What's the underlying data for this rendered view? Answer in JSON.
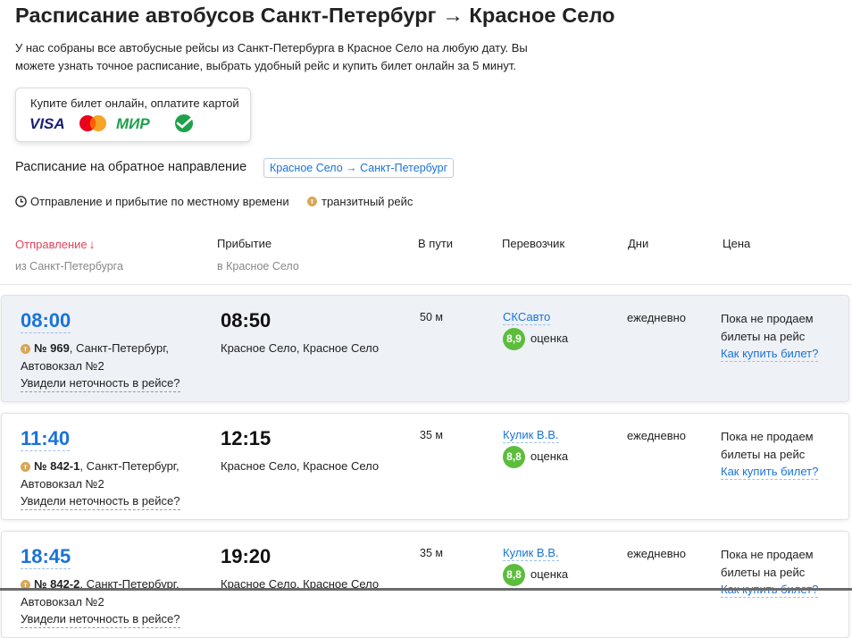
{
  "page": {
    "title": "Расписание автобусов Санкт-Петербург → Красное Село",
    "intro": "У нас собраны все автобусные рейсы из Санкт-Петербурга в Красное Село на любую дату. Вы можете узнать точное расписание, выбрать удобный рейс и купить билет онлайн за 5 минут."
  },
  "payment": {
    "label": "Купите билет онлайн, оплатите картой",
    "logos": [
      "visa",
      "mastercard",
      "mir",
      "sberbank"
    ]
  },
  "reverse": {
    "label": "Расписание на обратное направление",
    "link": "Красное Село → Санкт-Петербург"
  },
  "legend": {
    "local_time": "Отправление и прибытие по местному времени",
    "transit": "транзитный рейс",
    "transit_badge": "т"
  },
  "table": {
    "headers": {
      "departure": "Отправление",
      "departure_sort": "↓",
      "departure_sub": "из Санкт-Петербурга",
      "arrival": "Прибытие",
      "arrival_sub": "в Красное Село",
      "duration": "В пути",
      "carrier": "Перевозчик",
      "days": "Дни",
      "price": "Цена"
    },
    "rows": [
      {
        "departure": "08:00",
        "route_number": "№ 969",
        "route_from": ", Санкт-Петербург, Автовокзал №2",
        "report": "Увидели неточность в рейсе?",
        "arrival": "08:50",
        "arrival_place": "Красное Село, Красное Село",
        "duration": "50 м",
        "carrier": "СКСавто",
        "rating": "8,9",
        "rating_label": "оценка",
        "days": "ежедневно",
        "price_text": "Пока не продаем билеты на рейс",
        "how_to_buy": "Как купить билет?"
      },
      {
        "departure": "11:40",
        "route_number": "№ 842-1",
        "route_from": ", Санкт-Петербург, Автовокзал №2",
        "report": "Увидели неточность в рейсе?",
        "arrival": "12:15",
        "arrival_place": "Красное Село, Красное Село",
        "duration": "35 м",
        "carrier": "Кулик В.В.",
        "rating": "8,8",
        "rating_label": "оценка",
        "days": "ежедневно",
        "price_text": "Пока не продаем билеты на рейс",
        "how_to_buy": "Как купить билет?"
      },
      {
        "departure": "18:45",
        "route_number": "№ 842-2",
        "route_from": ", Санкт-Петербург, Автовокзал №2",
        "report": "Увидели неточность в рейсе?",
        "arrival": "19:20",
        "arrival_place": "Красное Село, Красное Село",
        "duration": "35 м",
        "carrier": "Кулик В.В.",
        "rating": "8,8",
        "rating_label": "оценка",
        "days": "ежедневно",
        "price_text": "Пока не продаем билеты на рейс",
        "how_to_buy": "Как купить билет?"
      }
    ]
  },
  "colors": {
    "link": "#1a73d8",
    "active_sort": "#e0445d",
    "rating_green": "#5cbd3d",
    "transit_badge": "#d8a657",
    "highlight_row": "#eef1f6"
  }
}
